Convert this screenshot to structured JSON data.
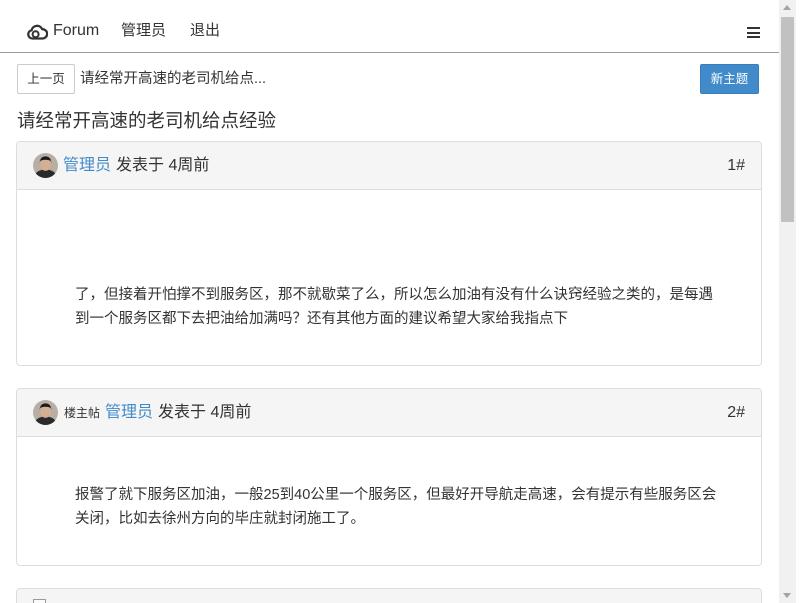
{
  "navbar": {
    "brand": "Forum",
    "brand_icon": "cloud-logo-icon",
    "links": [
      "管理员",
      "退出"
    ],
    "menu_icon": "hamburger-menu-icon"
  },
  "toolbar": {
    "prev_label": "上一页",
    "topic_crumb": "请经常开高速的老司机给点...",
    "new_topic_label": "新主题"
  },
  "topic": {
    "title": "请经常开高速的老司机给点经验"
  },
  "posts": [
    {
      "author": "管理员",
      "meta": "发表于 4周前",
      "floor": "1#",
      "content": "了，但接着开怕撑不到服务区，那不就歇菜了么，所以怎么加油有没有什么诀窍经验之类的，是每遇到一个服务区都下去把油给加满吗？还有其他方面的建议希望大家给我指点下"
    },
    {
      "badge": "楼主帖",
      "author": "管理员",
      "meta": "发表于 4周前",
      "floor": "2#",
      "content": "报警了就下服务区加油，一般25到40公里一个服务区，但最好开导航走高速，会有提示有些服务区会关闭，比如去徐州方向的毕庄就封闭施工了。"
    }
  ],
  "colors": {
    "link": "#428bca",
    "primary_button": "#428bca",
    "card_header": "#f5f5f5",
    "card_border": "#dddddd"
  }
}
